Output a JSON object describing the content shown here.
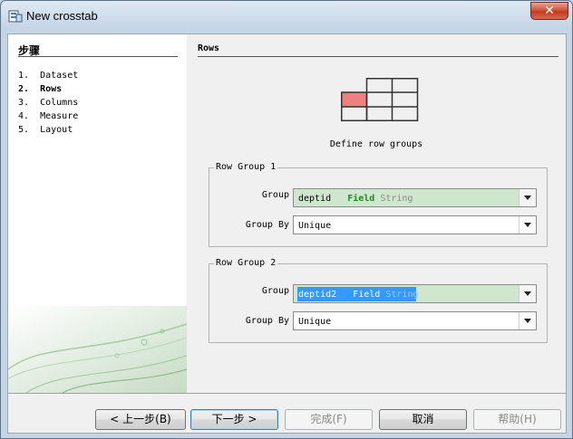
{
  "window": {
    "title": "New crosstab"
  },
  "left": {
    "title": "步骤",
    "steps": [
      {
        "num": "1.",
        "label": "Dataset"
      },
      {
        "num": "2.",
        "label": "Rows"
      },
      {
        "num": "3.",
        "label": "Columns"
      },
      {
        "num": "4.",
        "label": "Measure"
      },
      {
        "num": "5.",
        "label": "Layout"
      }
    ],
    "active_step": 2
  },
  "main": {
    "section_title": "Rows",
    "define_label": "Define row groups",
    "groups": [
      {
        "legend": "Row Group 1",
        "group_label": "Group",
        "field_name": "deptid",
        "field_kw": "Field",
        "field_type": "String",
        "groupby_label": "Group By",
        "groupby_value": "Unique"
      },
      {
        "legend": "Row Group 2",
        "group_label": "Group",
        "field_name": "deptid2",
        "field_kw": "Field",
        "field_type": "String",
        "groupby_label": "Group By",
        "groupby_value": "Unique"
      }
    ]
  },
  "buttons": {
    "back": "< 上一步(B)",
    "next": "下一步 >",
    "finish": "完成(F)",
    "cancel": "取消",
    "help": "帮助(H)"
  },
  "colors": {
    "highlight_cell": "#f08080",
    "selection": "#3399ff",
    "field_green": "#cfe7cf"
  }
}
